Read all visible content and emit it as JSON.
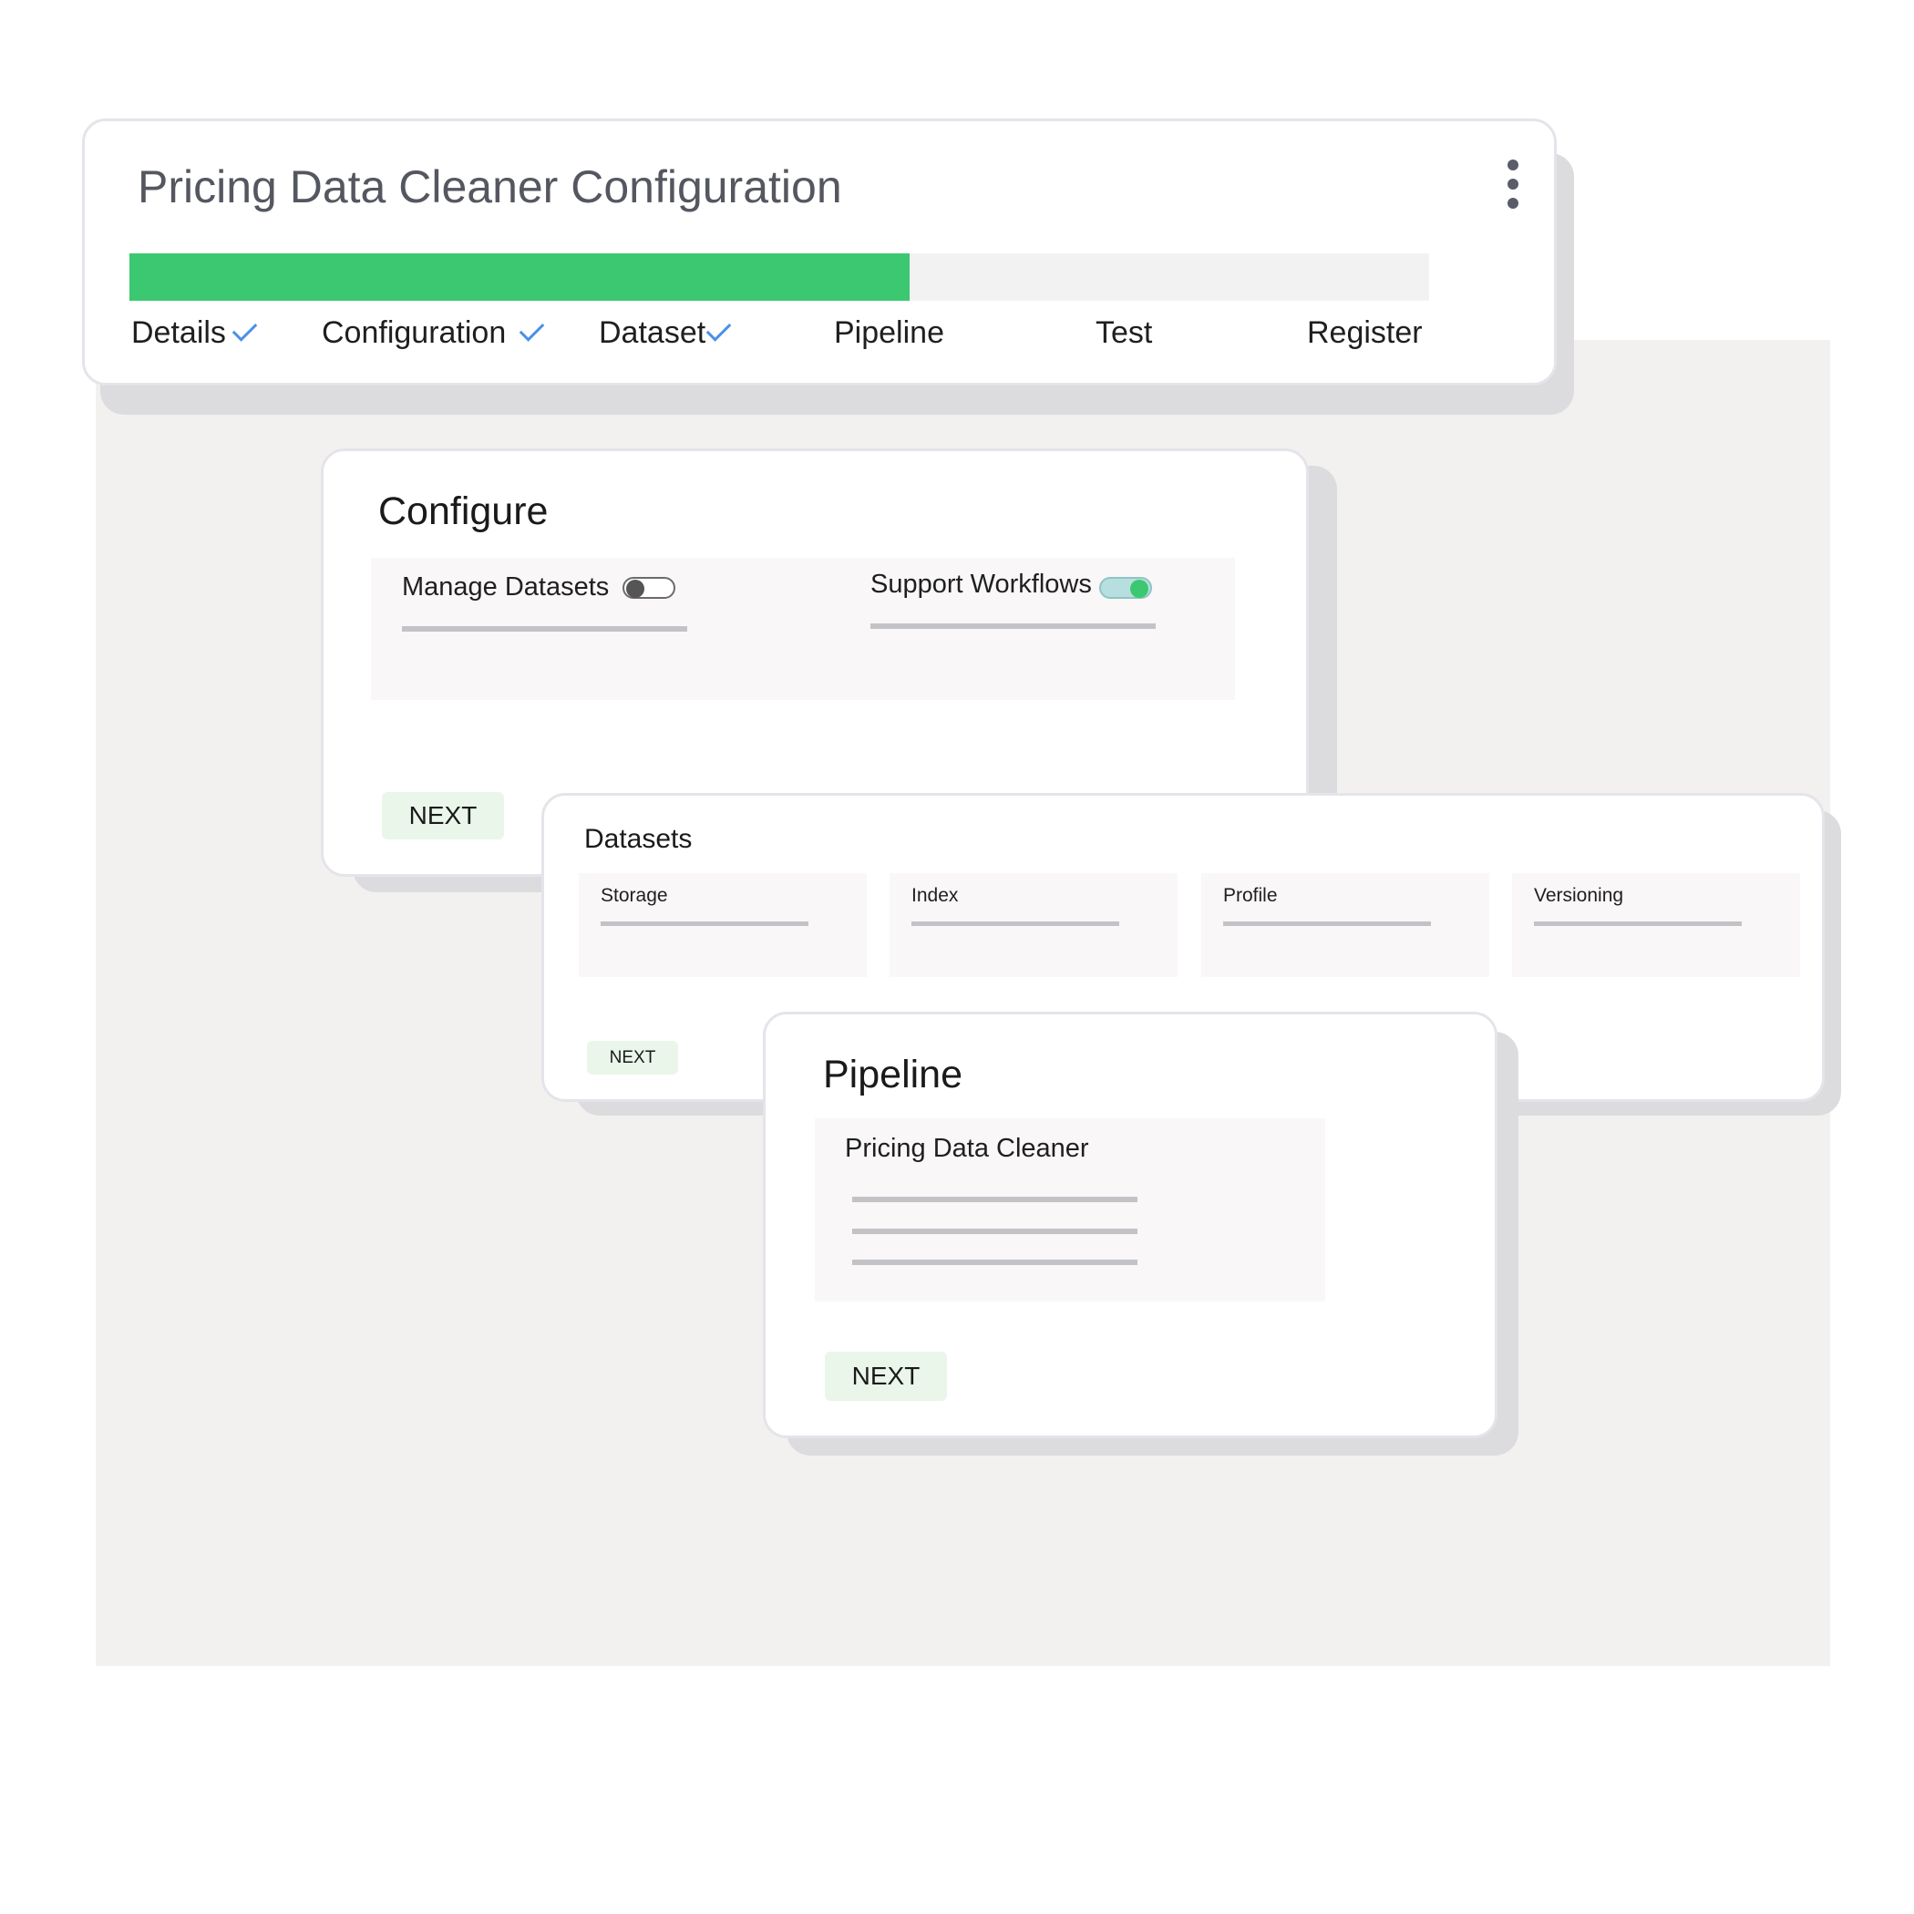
{
  "header": {
    "title": "Pricing Data Cleaner Configuration",
    "progress_percent": 60,
    "steps": [
      {
        "label": "Details",
        "completed": true
      },
      {
        "label": "Configuration",
        "completed": true
      },
      {
        "label": "Dataset",
        "completed": true
      },
      {
        "label": "Pipeline",
        "completed": false
      },
      {
        "label": "Test",
        "completed": false
      },
      {
        "label": "Register",
        "completed": false
      }
    ]
  },
  "configure": {
    "title": "Configure",
    "options": [
      {
        "label": "Manage Datasets",
        "enabled": false
      },
      {
        "label": "Support Workflows",
        "enabled": true
      }
    ],
    "next_label": "NEXT"
  },
  "datasets": {
    "title": "Datasets",
    "items": [
      "Storage",
      "Index",
      "Profile",
      "Versioning"
    ],
    "next_label": "NEXT"
  },
  "pipeline": {
    "title": "Pipeline",
    "item_label": "Pricing Data Cleaner",
    "next_label": "NEXT"
  },
  "colors": {
    "accent_green": "#3cc870",
    "check_blue": "#4a90e8",
    "button_bg": "#eaf6ea",
    "panel_bg": "#f3f1f0"
  }
}
